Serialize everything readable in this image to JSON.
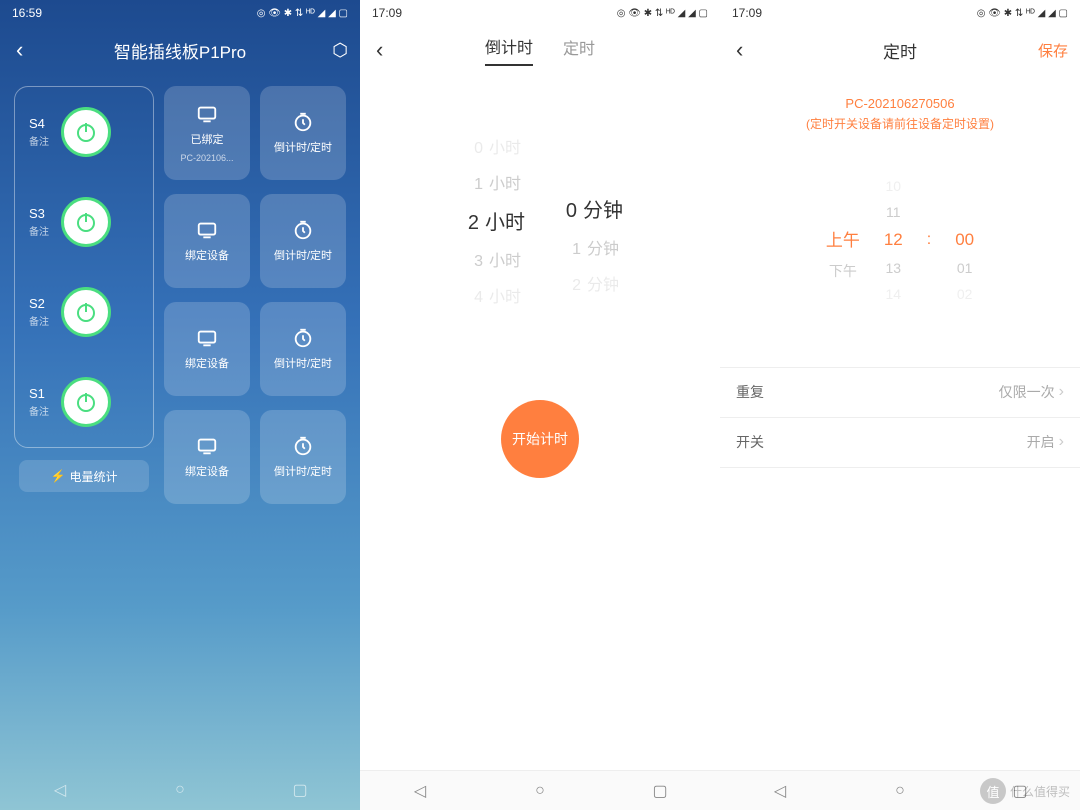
{
  "phone1": {
    "time": "16:59",
    "title": "智能插线板P1Pro",
    "switches": [
      {
        "name": "S4",
        "sub": "备注"
      },
      {
        "name": "S3",
        "sub": "备注"
      },
      {
        "name": "S2",
        "sub": "备注"
      },
      {
        "name": "S1",
        "sub": "备注"
      }
    ],
    "stats": "电量统计",
    "cards": [
      {
        "bind": "已绑定",
        "sub": "PC-202106...",
        "timer": "倒计时/定时"
      },
      {
        "bind": "绑定设备",
        "sub": "",
        "timer": "倒计时/定时"
      },
      {
        "bind": "绑定设备",
        "sub": "",
        "timer": "倒计时/定时"
      },
      {
        "bind": "绑定设备",
        "sub": "",
        "timer": "倒计时/定时"
      }
    ]
  },
  "phone2": {
    "time": "17:09",
    "tabs": {
      "countdown": "倒计时",
      "schedule": "定时"
    },
    "hours": {
      "n0": "0",
      "n1": "1",
      "n2": "2",
      "n3": "3",
      "n4": "4",
      "unit": "小时"
    },
    "minutes": {
      "n0": "0",
      "n1": "1",
      "n2": "2",
      "unit": "分钟"
    },
    "start": "开始计时"
  },
  "phone3": {
    "time": "17:09",
    "title": "定时",
    "save": "保存",
    "notice_title": "PC-202106270506",
    "notice_sub": "(定时开关设备请前往设备定时设置)",
    "ampm": {
      "am": "上午",
      "pm": "下午"
    },
    "hours": {
      "h10": "10",
      "h11": "11",
      "h12": "12",
      "h13": "13",
      "h14": "14"
    },
    "mins": {
      "m00": "00",
      "m01": "01",
      "m02": "02"
    },
    "colon": ":",
    "repeat": {
      "label": "重复",
      "value": "仅限一次"
    },
    "switch": {
      "label": "开关",
      "value": "开启"
    }
  },
  "watermark": {
    "badge": "值",
    "text": "什么值得买"
  }
}
